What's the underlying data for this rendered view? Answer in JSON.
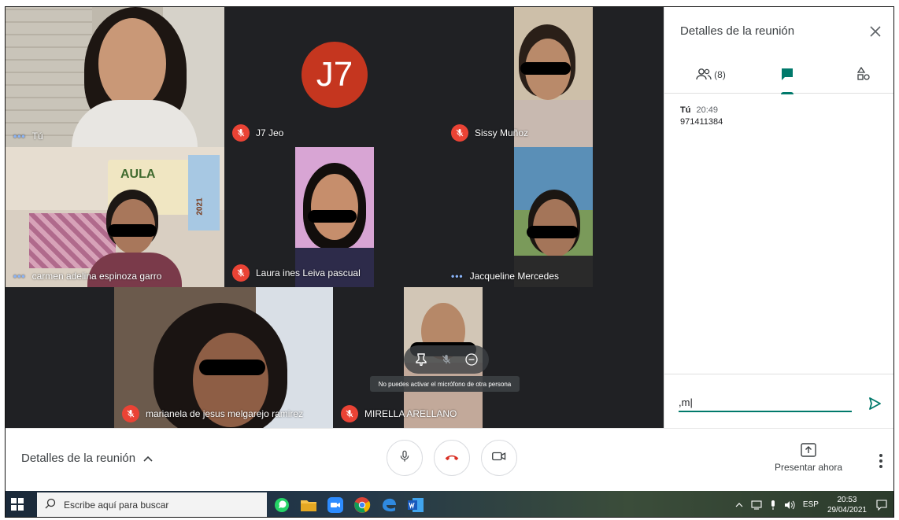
{
  "participants": {
    "self_name": "Tú",
    "j7_name": "J7 Jeo",
    "j7_avatar": "J7",
    "sissy_name": "Sissy Muñoz",
    "carmen_name": "carmen adelina espinoza garro",
    "laura_name": "Laura ines Leiva pascual",
    "jacqueline_name": "Jacqueline Mercedes",
    "marianela_name": "marianela de jesus melgarejo ramirez",
    "mirella_name": "MIRELLA ARELLANO",
    "speaking_indicator": "•••"
  },
  "wall_poster": {
    "aula": "AULA",
    "year": "2021"
  },
  "tooltip": "No puedes activar el micrófono de otra persona",
  "panel": {
    "title": "Detalles de la reunión",
    "people_count": "(8)",
    "message": {
      "sender": "Tú",
      "time": "20:49",
      "text": "971411384"
    },
    "chat_input_value": ",m|"
  },
  "bottom": {
    "meeting_details": "Detalles de la reunión",
    "present_label": "Presentar ahora"
  },
  "taskbar": {
    "search_placeholder": "Escribe aquí para buscar",
    "language": "ESP",
    "time": "20:53",
    "date": "29/04/2021"
  },
  "colors": {
    "accent": "#00796b",
    "mute_red": "#ea4335",
    "avatar_red": "#c5361f",
    "grid_bg": "#202124",
    "hangup_red": "#d93025"
  },
  "icons": [
    "mic-off-icon",
    "pin-icon",
    "remove-icon",
    "close-icon",
    "people-icon",
    "chat-icon",
    "activities-icon",
    "send-icon",
    "chevron-up-icon",
    "mic-icon",
    "hangup-icon",
    "camera-icon",
    "present-icon",
    "more-vert-icon",
    "windows-icon",
    "search-icon"
  ]
}
